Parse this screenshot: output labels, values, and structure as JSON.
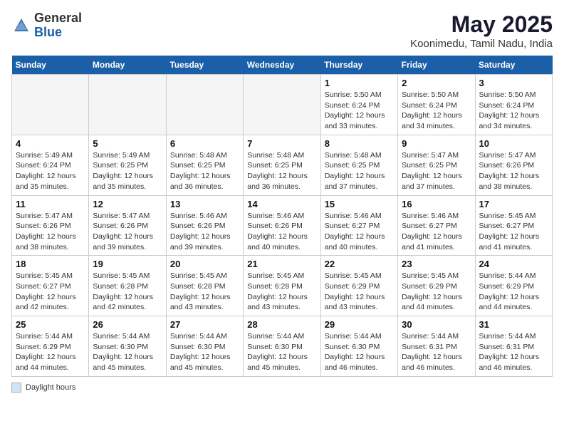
{
  "header": {
    "logo_general": "General",
    "logo_blue": "Blue",
    "month_title": "May 2025",
    "location": "Koonimedu, Tamil Nadu, India"
  },
  "weekdays": [
    "Sunday",
    "Monday",
    "Tuesday",
    "Wednesday",
    "Thursday",
    "Friday",
    "Saturday"
  ],
  "footer": {
    "label": "Daylight hours"
  },
  "weeks": [
    [
      {
        "day": "",
        "info": ""
      },
      {
        "day": "",
        "info": ""
      },
      {
        "day": "",
        "info": ""
      },
      {
        "day": "",
        "info": ""
      },
      {
        "day": "1",
        "info": "Sunrise: 5:50 AM\nSunset: 6:24 PM\nDaylight: 12 hours and 33 minutes."
      },
      {
        "day": "2",
        "info": "Sunrise: 5:50 AM\nSunset: 6:24 PM\nDaylight: 12 hours and 34 minutes."
      },
      {
        "day": "3",
        "info": "Sunrise: 5:50 AM\nSunset: 6:24 PM\nDaylight: 12 hours and 34 minutes."
      }
    ],
    [
      {
        "day": "4",
        "info": "Sunrise: 5:49 AM\nSunset: 6:24 PM\nDaylight: 12 hours and 35 minutes."
      },
      {
        "day": "5",
        "info": "Sunrise: 5:49 AM\nSunset: 6:25 PM\nDaylight: 12 hours and 35 minutes."
      },
      {
        "day": "6",
        "info": "Sunrise: 5:48 AM\nSunset: 6:25 PM\nDaylight: 12 hours and 36 minutes."
      },
      {
        "day": "7",
        "info": "Sunrise: 5:48 AM\nSunset: 6:25 PM\nDaylight: 12 hours and 36 minutes."
      },
      {
        "day": "8",
        "info": "Sunrise: 5:48 AM\nSunset: 6:25 PM\nDaylight: 12 hours and 37 minutes."
      },
      {
        "day": "9",
        "info": "Sunrise: 5:47 AM\nSunset: 6:25 PM\nDaylight: 12 hours and 37 minutes."
      },
      {
        "day": "10",
        "info": "Sunrise: 5:47 AM\nSunset: 6:26 PM\nDaylight: 12 hours and 38 minutes."
      }
    ],
    [
      {
        "day": "11",
        "info": "Sunrise: 5:47 AM\nSunset: 6:26 PM\nDaylight: 12 hours and 38 minutes."
      },
      {
        "day": "12",
        "info": "Sunrise: 5:47 AM\nSunset: 6:26 PM\nDaylight: 12 hours and 39 minutes."
      },
      {
        "day": "13",
        "info": "Sunrise: 5:46 AM\nSunset: 6:26 PM\nDaylight: 12 hours and 39 minutes."
      },
      {
        "day": "14",
        "info": "Sunrise: 5:46 AM\nSunset: 6:26 PM\nDaylight: 12 hours and 40 minutes."
      },
      {
        "day": "15",
        "info": "Sunrise: 5:46 AM\nSunset: 6:27 PM\nDaylight: 12 hours and 40 minutes."
      },
      {
        "day": "16",
        "info": "Sunrise: 5:46 AM\nSunset: 6:27 PM\nDaylight: 12 hours and 41 minutes."
      },
      {
        "day": "17",
        "info": "Sunrise: 5:45 AM\nSunset: 6:27 PM\nDaylight: 12 hours and 41 minutes."
      }
    ],
    [
      {
        "day": "18",
        "info": "Sunrise: 5:45 AM\nSunset: 6:27 PM\nDaylight: 12 hours and 42 minutes."
      },
      {
        "day": "19",
        "info": "Sunrise: 5:45 AM\nSunset: 6:28 PM\nDaylight: 12 hours and 42 minutes."
      },
      {
        "day": "20",
        "info": "Sunrise: 5:45 AM\nSunset: 6:28 PM\nDaylight: 12 hours and 43 minutes."
      },
      {
        "day": "21",
        "info": "Sunrise: 5:45 AM\nSunset: 6:28 PM\nDaylight: 12 hours and 43 minutes."
      },
      {
        "day": "22",
        "info": "Sunrise: 5:45 AM\nSunset: 6:29 PM\nDaylight: 12 hours and 43 minutes."
      },
      {
        "day": "23",
        "info": "Sunrise: 5:45 AM\nSunset: 6:29 PM\nDaylight: 12 hours and 44 minutes."
      },
      {
        "day": "24",
        "info": "Sunrise: 5:44 AM\nSunset: 6:29 PM\nDaylight: 12 hours and 44 minutes."
      }
    ],
    [
      {
        "day": "25",
        "info": "Sunrise: 5:44 AM\nSunset: 6:29 PM\nDaylight: 12 hours and 44 minutes."
      },
      {
        "day": "26",
        "info": "Sunrise: 5:44 AM\nSunset: 6:30 PM\nDaylight: 12 hours and 45 minutes."
      },
      {
        "day": "27",
        "info": "Sunrise: 5:44 AM\nSunset: 6:30 PM\nDaylight: 12 hours and 45 minutes."
      },
      {
        "day": "28",
        "info": "Sunrise: 5:44 AM\nSunset: 6:30 PM\nDaylight: 12 hours and 45 minutes."
      },
      {
        "day": "29",
        "info": "Sunrise: 5:44 AM\nSunset: 6:30 PM\nDaylight: 12 hours and 46 minutes."
      },
      {
        "day": "30",
        "info": "Sunrise: 5:44 AM\nSunset: 6:31 PM\nDaylight: 12 hours and 46 minutes."
      },
      {
        "day": "31",
        "info": "Sunrise: 5:44 AM\nSunset: 6:31 PM\nDaylight: 12 hours and 46 minutes."
      }
    ]
  ]
}
